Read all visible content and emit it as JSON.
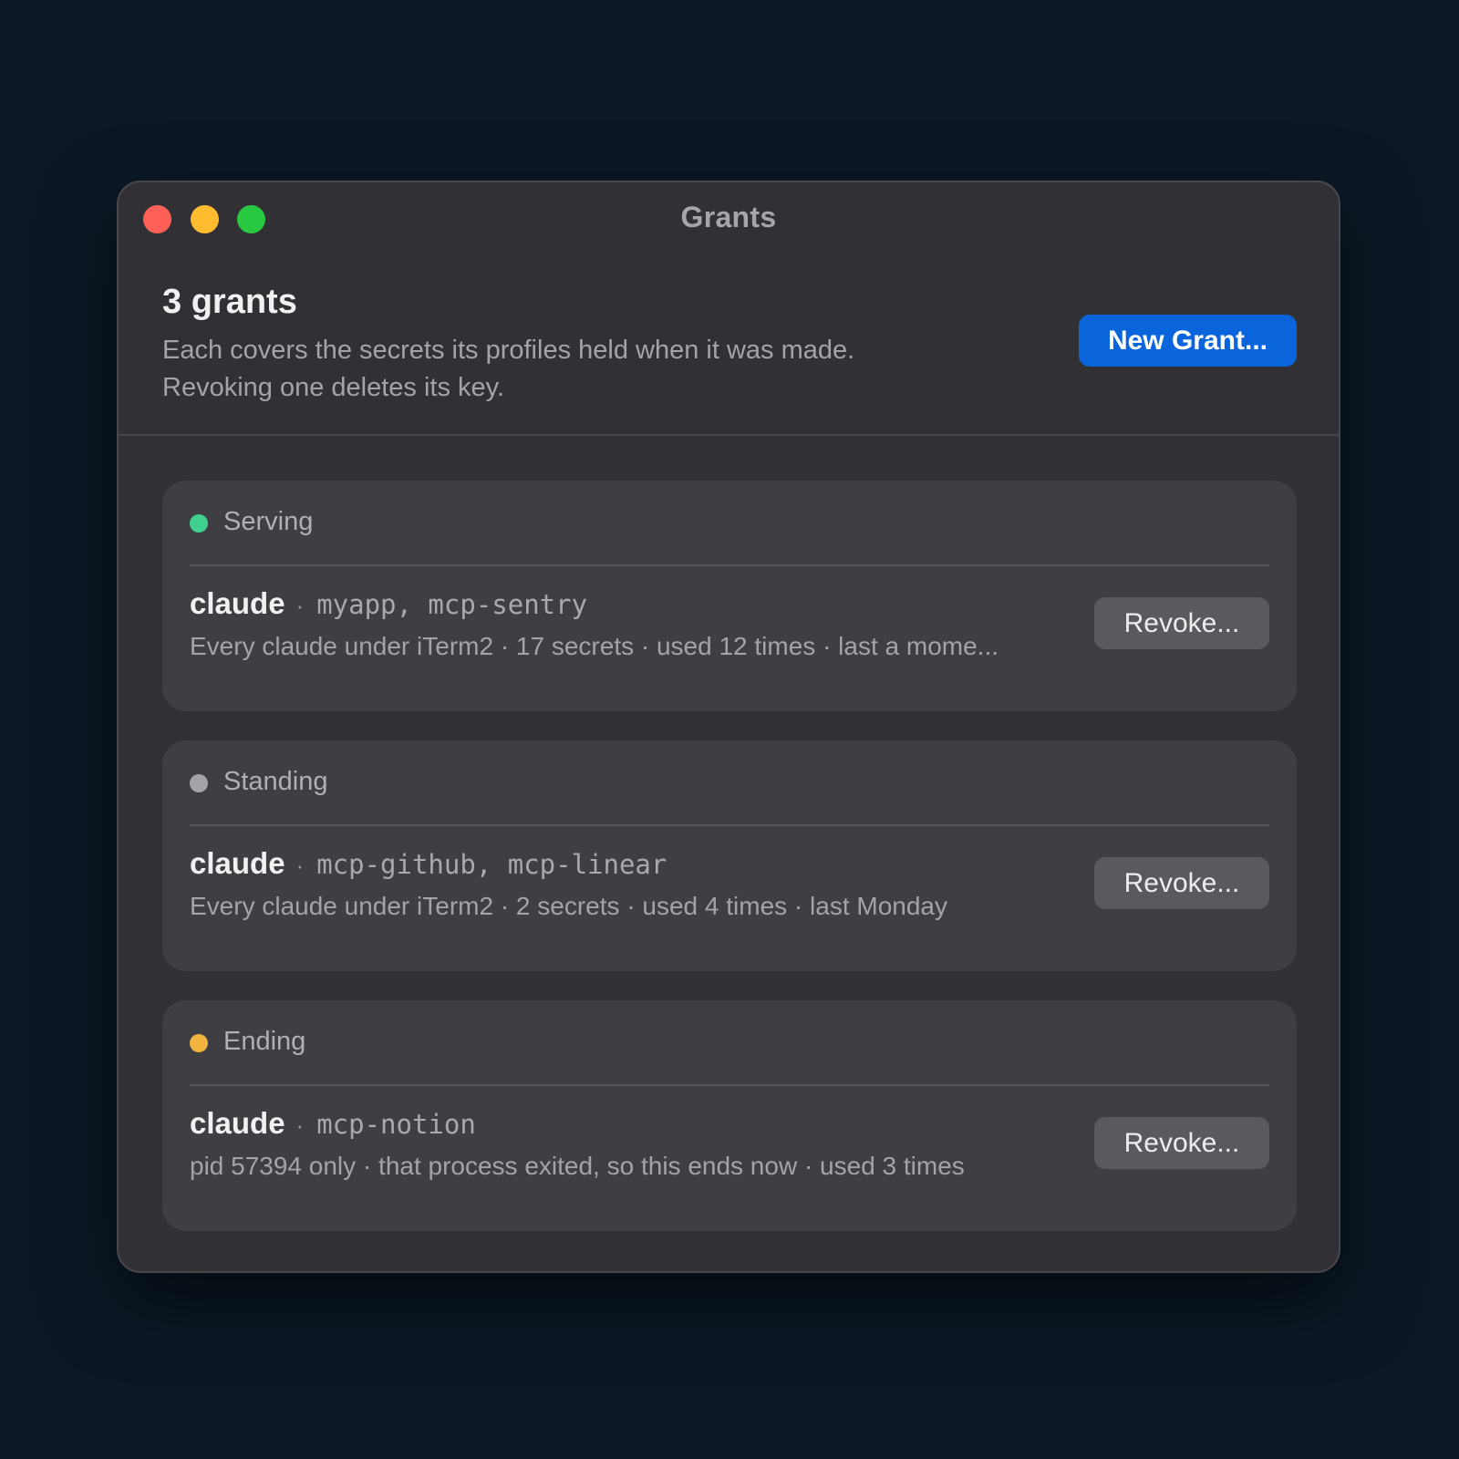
{
  "window": {
    "title": "Grants"
  },
  "header": {
    "count_title": "3 grants",
    "subtitle_line1": "Each covers the secrets its profiles held when it was made.",
    "subtitle_line2": "Revoking one deletes its key.",
    "new_grant_label": "New Grant..."
  },
  "grants": [
    {
      "status": "Serving",
      "status_color": "#3fcf8e",
      "agent": "claude",
      "separator": "·",
      "profiles": "myapp, mcp-sentry",
      "detail": "Every claude under iTerm2 · 17 secrets · used 12 times · last a mome...",
      "revoke_label": "Revoke..."
    },
    {
      "status": "Standing",
      "status_color": "#a4a4a8",
      "agent": "claude",
      "separator": "·",
      "profiles": "mcp-github, mcp-linear",
      "detail": "Every claude under iTerm2 · 2 secrets · used 4 times · last Monday",
      "revoke_label": "Revoke..."
    },
    {
      "status": "Ending",
      "status_color": "#f1b43e",
      "agent": "claude",
      "separator": "·",
      "profiles": "mcp-notion",
      "detail": "pid 57394 only · that process exited, so this ends now · used 3 times",
      "revoke_label": "Revoke..."
    }
  ]
}
